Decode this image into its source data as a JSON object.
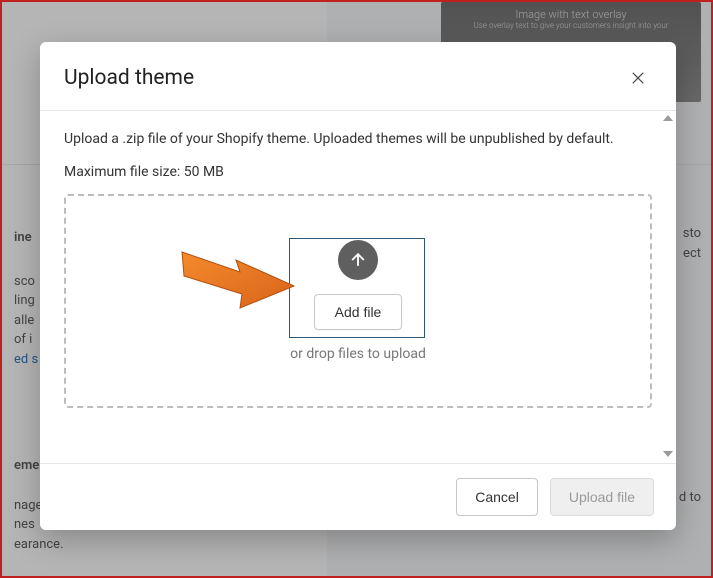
{
  "modal": {
    "title": "Upload theme",
    "description": "Upload a .zip file of your Shopify theme. Uploaded themes will be unpublished by default.",
    "max_size_label": "Maximum file size: 50 MB",
    "add_file_label": "Add file",
    "drop_hint": "or drop files to upload",
    "cancel_label": "Cancel",
    "upload_label": "Upload file"
  },
  "background": {
    "hero_title": "Image with text overlay",
    "hero_sub": "Use overlay text to give your customers insight into your",
    "left_section1_head": "ine",
    "left_frag2a": "sco",
    "left_frag2b": "ling",
    "left_frag2c": "alle",
    "left_frag2d": "of i",
    "left_frag_link": "ed s",
    "left_section2_head": "eme",
    "left_frag3a": "nage",
    "left_frag3b": "nes",
    "left_frag3c": "earance.",
    "right_frag1a": "sto",
    "right_frag1b": "ect",
    "right_frag2": "d to"
  },
  "icons": {
    "close": "close-icon",
    "upload_arrow": "arrow-up-icon"
  }
}
